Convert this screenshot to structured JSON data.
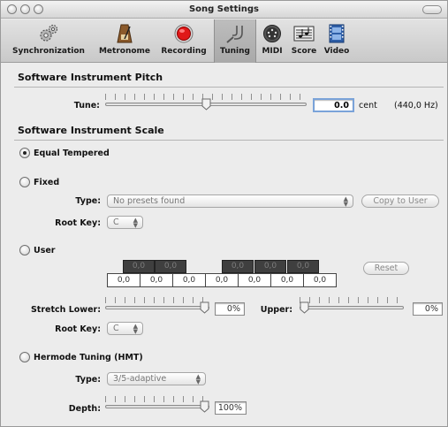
{
  "window": {
    "title": "Song Settings"
  },
  "toolbar": {
    "items": [
      {
        "label": "Synchronization",
        "icon": "gears-icon"
      },
      {
        "label": "Metronome",
        "icon": "metronome-icon"
      },
      {
        "label": "Recording",
        "icon": "record-icon"
      },
      {
        "label": "Tuning",
        "icon": "tuning-fork-icon",
        "active": true
      },
      {
        "label": "MIDI",
        "icon": "midi-port-icon"
      },
      {
        "label": "Score",
        "icon": "score-icon"
      },
      {
        "label": "Video",
        "icon": "film-icon"
      }
    ]
  },
  "pitch": {
    "title": "Software Instrument Pitch",
    "tune_label": "Tune:",
    "tune_value": "0.0",
    "tune_unit": "cent",
    "tune_hz": "(440,0 Hz)",
    "tune_slider_fraction": 0.5
  },
  "scale": {
    "title": "Software Instrument Scale",
    "equal_tempered": {
      "label": "Equal Tempered",
      "selected": true
    },
    "fixed": {
      "label": "Fixed",
      "type_label": "Type:",
      "type_value": "No presets found",
      "copy_button": "Copy to User",
      "root_key_label": "Root Key:",
      "root_key_value": "C"
    },
    "user": {
      "label": "User",
      "black_keys": [
        "0,0",
        "0,0",
        "0,0",
        "0,0",
        "0,0"
      ],
      "white_keys": [
        "0,0",
        "0,0",
        "0,0",
        "0,0",
        "0,0",
        "0,0",
        "0,0"
      ],
      "reset_button": "Reset",
      "stretch_lower_label": "Stretch Lower:",
      "stretch_lower_value": "0%",
      "stretch_lower_fraction": 1.0,
      "upper_label": "Upper:",
      "upper_value": "0%",
      "upper_fraction": 0.0,
      "root_key_label": "Root Key:",
      "root_key_value": "C"
    },
    "hermode": {
      "label": "Hermode Tuning (HMT)",
      "type_label": "Type:",
      "type_value": "3/5-adaptive",
      "depth_label": "Depth:",
      "depth_value": "100%",
      "depth_fraction": 1.0
    }
  }
}
